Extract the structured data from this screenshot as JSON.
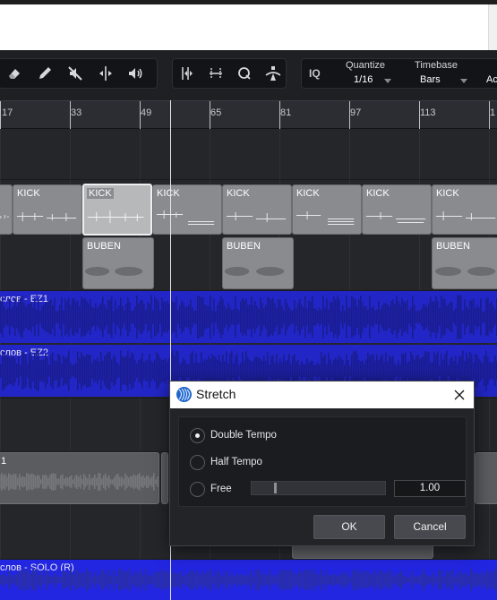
{
  "toolbar": {
    "tools": [
      {
        "icon": "eraser-icon"
      },
      {
        "icon": "pencil-icon"
      },
      {
        "icon": "mute-icon"
      },
      {
        "icon": "split-icon"
      },
      {
        "icon": "speaker-icon"
      }
    ],
    "snap_tools": [
      {
        "icon": "snap-icon"
      },
      {
        "icon": "snap-grid-icon"
      },
      {
        "icon": "quantize-q-icon"
      },
      {
        "icon": "metronome-icon"
      }
    ],
    "iq_label": "IQ",
    "quantize_label": "Quantize",
    "quantize_value": "1/16",
    "timebase_label": "Timebase",
    "timebase_value": "Bars",
    "partial_label": "Ac"
  },
  "ruler": {
    "marks": [
      "17",
      "33",
      "49",
      "65",
      "81",
      "97",
      "113",
      "1"
    ]
  },
  "tracks": {
    "kick_clips": [
      "KICK",
      "KICK",
      "KICK",
      "KICK",
      "KICK",
      "KICK",
      "KICK"
    ],
    "buben_clips": [
      "BUBEN",
      "BUBEN",
      "BUBEN"
    ],
    "ez1_title": "слов - EZ1",
    "ez2_title": "слов - EZ2",
    "grey_clip_label": "1",
    "solo_title": "слов - SOLO (R)"
  },
  "dialog": {
    "title": "Stretch",
    "options": [
      {
        "label": "Double Tempo",
        "selected": true
      },
      {
        "label": "Half Tempo",
        "selected": false
      },
      {
        "label": "Free",
        "selected": false
      }
    ],
    "free_slider_fraction": 0.17,
    "free_value": "1.00",
    "ok_label": "OK",
    "cancel_label": "Cancel"
  },
  "colors": {
    "audio_track": "#2226c6",
    "clip": "#8a8b8e",
    "dialog_icon": "#1f66c9"
  }
}
